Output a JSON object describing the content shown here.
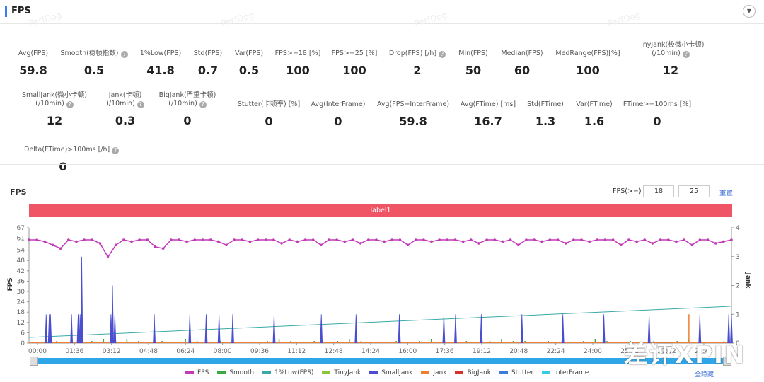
{
  "header": {
    "title": "FPS",
    "watermark": "PerfDog"
  },
  "metrics": [
    {
      "label": "Avg(FPS)",
      "value": "59.8"
    },
    {
      "label": "Smooth(稳帧指数)",
      "value": "0.5",
      "help": true
    },
    {
      "label": "1%Low(FPS)",
      "value": "41.8"
    },
    {
      "label": "Std(FPS)",
      "value": "0.7"
    },
    {
      "label": "Var(FPS)",
      "value": "0.5"
    },
    {
      "label": "FPS>=18 [%]",
      "value": "100"
    },
    {
      "label": "FPS>=25 [%]",
      "value": "100"
    },
    {
      "label": "Drop(FPS) [/h]",
      "value": "2",
      "help": true
    },
    {
      "label": "Min(FPS)",
      "value": "50"
    },
    {
      "label": "Median(FPS)",
      "value": "60"
    },
    {
      "label": "MedRange(FPS)[%]",
      "value": "100"
    },
    {
      "label": "TinyJank(极微小卡顿)",
      "label2": "(/10min)",
      "value": "12",
      "help": true
    },
    {
      "label": "SmallJank(微小卡顿)",
      "label2": "(/10min)",
      "value": "12",
      "help": true
    },
    {
      "label": "Jank(卡顿)",
      "label2": "(/10min)",
      "value": "0.3",
      "help": true
    },
    {
      "label": "BigJank(严重卡顿)",
      "label2": "(/10min)",
      "value": "0",
      "help": true
    },
    {
      "label": "Stutter(卡顿率) [%]",
      "value": "0"
    },
    {
      "label": "Avg(InterFrame)",
      "value": "0"
    },
    {
      "label": "Avg(FPS+InterFrame)",
      "value": "59.8"
    },
    {
      "label": "Avg(FTime) [ms]",
      "value": "16.7"
    },
    {
      "label": "Std(FTime)",
      "value": "1.3"
    },
    {
      "label": "Var(FTime)",
      "value": "1.6"
    },
    {
      "label": "FTime>=100ms [%]",
      "value": "0"
    },
    {
      "label": "Delta(FTime)>100ms [/h]",
      "value": "0",
      "help": true
    }
  ],
  "chart_controls": {
    "title": "FPS",
    "fps_ge_label": "FPS(>=)",
    "threshold1": "18",
    "threshold2": "25",
    "reset": "重置",
    "hide_all": "全隐藏",
    "label_bar": "label1"
  },
  "chart_data": {
    "type": "line",
    "ylabel": "FPS",
    "y2label": "Jank",
    "ylim": [
      0,
      67
    ],
    "y_ticks": [
      0,
      6,
      12,
      18,
      24,
      30,
      36,
      42,
      48,
      54,
      61,
      67
    ],
    "y2lim": [
      0,
      4
    ],
    "y2_ticks": [
      0,
      1,
      2,
      3,
      4
    ],
    "x_ticks": [
      "00:00",
      "01:36",
      "03:12",
      "04:48",
      "06:24",
      "08:00",
      "09:36",
      "11:12",
      "12:48",
      "14:24",
      "16:00",
      "17:36",
      "19:12",
      "20:48",
      "22:24",
      "24:00",
      "25:36",
      "27:12",
      "28:48"
    ],
    "x_range_seconds": [
      0,
      1800
    ],
    "legend": [
      "FPS",
      "Smooth",
      "1%Low(FPS)",
      "TinyJank",
      "SmallJank",
      "Jank",
      "BigJank",
      "Stutter",
      "InterFrame"
    ],
    "colors": {
      "FPS": "#c23ab8",
      "Smooth": "#3aa845",
      "1%Low(FPS)": "#3aa9a6",
      "TinyJank": "#8cc43c",
      "SmallJank": "#4b4fcf",
      "Jank": "#f07e32",
      "BigJank": "#d8302c",
      "Stutter": "#3d7bd8",
      "InterFrame": "#3cc8e8"
    },
    "fps_series": [
      60,
      60,
      59,
      57,
      55,
      60,
      59,
      60,
      60,
      58,
      50,
      57,
      60,
      59,
      60,
      60,
      56,
      55,
      60,
      60,
      59,
      60,
      60,
      60,
      59,
      57,
      60,
      60,
      59,
      60,
      60,
      60,
      58,
      60,
      59,
      60,
      60,
      57,
      60,
      60,
      59,
      60,
      58,
      60,
      60,
      59,
      60,
      60,
      57,
      60,
      60,
      59,
      60,
      60,
      60,
      59,
      60,
      58,
      60,
      60,
      59,
      60,
      57,
      60,
      60,
      59,
      60,
      60,
      58,
      60,
      60,
      59,
      60,
      60,
      60,
      57,
      60,
      59,
      60,
      58,
      60,
      60,
      59,
      60,
      57,
      60,
      60,
      58,
      59,
      60
    ],
    "one_percent_low": {
      "start": 3.3,
      "end": 21.4
    },
    "smalljank_spikes": [
      {
        "t": "00:44",
        "v": 1
      },
      {
        "t": "00:52",
        "v": 1
      },
      {
        "t": "00:55",
        "v": 1
      },
      {
        "t": "01:49",
        "v": 1
      },
      {
        "t": "02:06",
        "v": 1
      },
      {
        "t": "02:11",
        "v": 1
      },
      {
        "t": "02:15",
        "v": 3
      },
      {
        "t": "03:30",
        "v": 1
      },
      {
        "t": "03:34",
        "v": 2
      },
      {
        "t": "03:40",
        "v": 1
      },
      {
        "t": "05:21",
        "v": 1
      },
      {
        "t": "06:52",
        "v": 1
      },
      {
        "t": "07:34",
        "v": 1
      },
      {
        "t": "08:07",
        "v": 1
      },
      {
        "t": "08:42",
        "v": 1
      },
      {
        "t": "10:28",
        "v": 1
      },
      {
        "t": "12:29",
        "v": 1
      },
      {
        "t": "13:58",
        "v": 1
      },
      {
        "t": "15:49",
        "v": 1
      },
      {
        "t": "17:43",
        "v": 1
      },
      {
        "t": "18:13",
        "v": 1
      },
      {
        "t": "19:19",
        "v": 1
      },
      {
        "t": "21:03",
        "v": 1
      },
      {
        "t": "22:48",
        "v": 1
      },
      {
        "t": "24:33",
        "v": 1
      },
      {
        "t": "26:29",
        "v": 1
      },
      {
        "t": "28:39",
        "v": 1
      },
      {
        "t": "29:53",
        "v": 1
      },
      {
        "t": "30:00",
        "v": 1
      }
    ],
    "jank_spikes": [
      {
        "t": "28:11",
        "v": 1
      }
    ],
    "smooth_series": [
      0,
      0,
      1,
      0,
      0,
      1,
      2,
      1,
      2,
      1,
      0,
      1,
      0,
      2,
      1,
      0,
      1,
      1,
      0,
      0,
      1,
      2,
      1,
      0,
      1,
      0,
      1,
      2,
      1,
      0,
      0,
      1,
      0,
      1,
      2,
      1,
      0,
      1,
      0,
      1,
      2,
      1,
      1,
      0,
      1,
      0,
      0,
      1,
      2,
      1,
      0,
      1,
      0,
      1,
      0,
      1,
      2,
      1,
      0,
      1
    ]
  },
  "overlay_watermark": "差评XPIN"
}
